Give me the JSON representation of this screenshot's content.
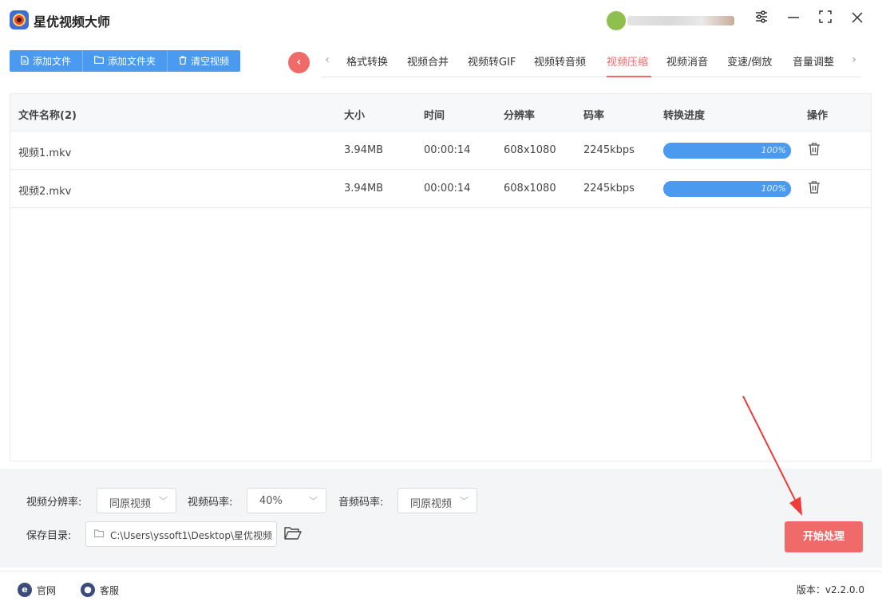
{
  "app": {
    "title": "星优视频大师"
  },
  "toolbar": {
    "add_file": "添加文件",
    "add_folder": "添加文件夹",
    "clear_videos": "清空视频"
  },
  "tabs": [
    {
      "label": "格式转换",
      "active": false
    },
    {
      "label": "视频合并",
      "active": false
    },
    {
      "label": "视频转GIF",
      "active": false
    },
    {
      "label": "视频转音频",
      "active": false
    },
    {
      "label": "视频压缩",
      "active": true
    },
    {
      "label": "视频消音",
      "active": false
    },
    {
      "label": "变速/倒放",
      "active": false
    },
    {
      "label": "音量调整",
      "active": false
    }
  ],
  "accent_color": "#f06a6a",
  "primary_color": "#4a9bf0",
  "table": {
    "headers": {
      "name": "文件名称(2)",
      "size": "大小",
      "time": "时间",
      "resolution": "分辨率",
      "bitrate": "码率",
      "progress": "转换进度",
      "action": "操作"
    },
    "rows": [
      {
        "name": "视频1.mkv",
        "size": "3.94MB",
        "time": "00:00:14",
        "resolution": "608x1080",
        "bitrate": "2245kbps",
        "progress_label": "100%",
        "progress": 1.0
      },
      {
        "name": "视频2.mkv",
        "size": "3.94MB",
        "time": "00:00:14",
        "resolution": "608x1080",
        "bitrate": "2245kbps",
        "progress_label": "100%",
        "progress": 1.0
      }
    ]
  },
  "settings": {
    "video_resolution_label": "视频分辨率:",
    "video_resolution_value": "同原视频",
    "video_bitrate_label": "视频码率:",
    "video_bitrate_value": "40%",
    "audio_bitrate_label": "音频码率:",
    "audio_bitrate_value": "同原视频",
    "save_dir_label": "保存目录:",
    "save_dir_value": "C:\\Users\\yssoft1\\Desktop\\星优视频"
  },
  "start_button": "开始处理",
  "statusbar": {
    "website": "官网",
    "support": "客服",
    "version": "版本：v2.2.0.0"
  }
}
